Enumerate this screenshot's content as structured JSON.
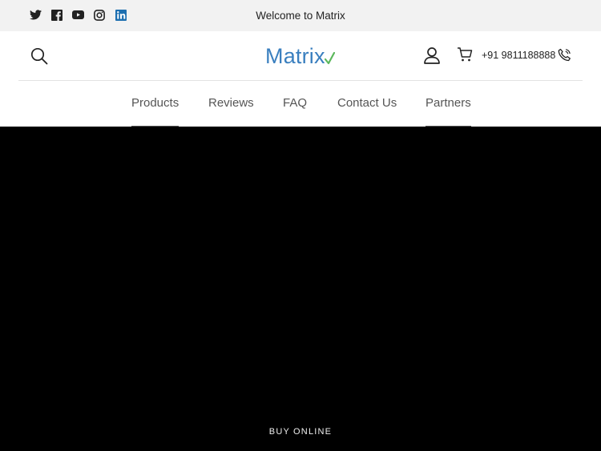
{
  "topbar": {
    "welcome_text": "Welcome to Matrix",
    "socials": [
      {
        "name": "twitter-icon"
      },
      {
        "name": "facebook-icon"
      },
      {
        "name": "youtube-icon"
      },
      {
        "name": "instagram-icon"
      },
      {
        "name": "linkedin-icon"
      }
    ]
  },
  "header": {
    "logo_text": "Matrix",
    "phone": "+91 9811188888"
  },
  "nav": {
    "items": [
      {
        "label": "Products"
      },
      {
        "label": "Reviews"
      },
      {
        "label": "FAQ"
      },
      {
        "label": "Contact Us"
      },
      {
        "label": "Partners"
      }
    ]
  },
  "hero": {
    "cta_label": "BUY ONLINE"
  },
  "colors": {
    "brand": "#3a7fbf",
    "tick": "#5cb85c",
    "topbar_bg": "#f2f2f2",
    "hero_bg": "#000000"
  }
}
